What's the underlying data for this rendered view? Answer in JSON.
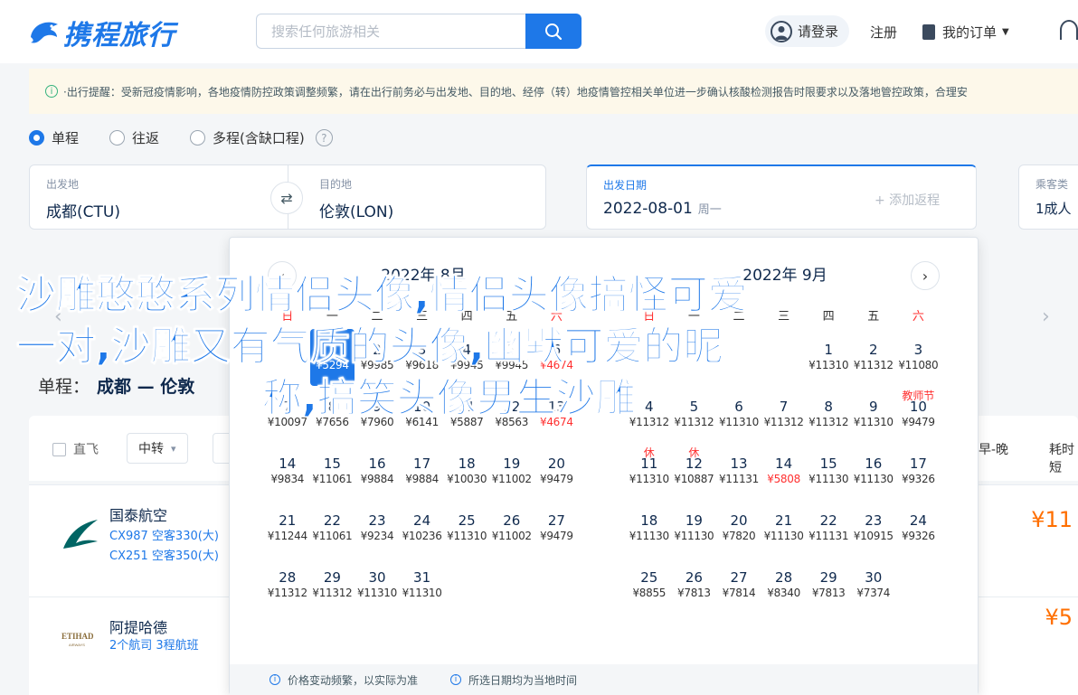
{
  "header": {
    "logo_text": "携程旅行",
    "search_placeholder": "搜索任何旅游相关",
    "login": "请登录",
    "register": "注册",
    "orders": "我的订单"
  },
  "notice": {
    "text": "·出行提醒：受新冠疫情影响，各地疫情防控政策调整频繁，请在出行前务必与出发地、目的地、经停（转）地疫情管控相关单位进一步确认核酸检测报告时限要求以及落地管控政策，合理安"
  },
  "trip_types": {
    "oneway": "单程",
    "roundtrip": "往返",
    "multi": "多程(含缺口程)"
  },
  "form": {
    "from_label": "出发地",
    "from_value": "成都(CTU)",
    "to_label": "目的地",
    "to_value": "伦敦(LON)",
    "date_label": "出发日期",
    "date_value": "2022-08-01",
    "date_weekday": "周一",
    "add_return": "+ 添加返程",
    "pax_label": "乘客类",
    "pax_value": "1成人"
  },
  "results": {
    "route_prefix": "单程：",
    "route_value": "成都 — 伦敦",
    "filter_direct": "直飞",
    "filter_transfer": "中转",
    "sort_early_late": "早-晚",
    "sort_duration": "耗时短",
    "flights": [
      {
        "airline": "国泰航空",
        "line1": "CX987 空客330(大)",
        "line2": "CX251 空客350(大)",
        "price": "¥11"
      },
      {
        "airline": "阿提哈德",
        "line1": "2个航司  3程航班",
        "line2": "",
        "price": "¥5"
      }
    ]
  },
  "calendar": {
    "weekdays": [
      "日",
      "一",
      "二",
      "三",
      "四",
      "五",
      "六"
    ],
    "months": [
      {
        "title": "2022年 8月",
        "offset": 1,
        "days": [
          {
            "d": "1",
            "p": "¥5294",
            "sel": true
          },
          {
            "d": "2",
            "p": "¥9985"
          },
          {
            "d": "3",
            "p": "¥9618"
          },
          {
            "d": "4",
            "p": "¥9945"
          },
          {
            "d": "5",
            "p": "¥9945"
          },
          {
            "d": "6",
            "p": "¥4674",
            "low": true
          },
          {
            "d": "7",
            "p": "¥10097"
          },
          {
            "d": "8",
            "p": "¥7656"
          },
          {
            "d": "9",
            "p": "¥7960"
          },
          {
            "d": "10",
            "p": "¥6141"
          },
          {
            "d": "11",
            "p": "¥5887"
          },
          {
            "d": "12",
            "p": "¥8563"
          },
          {
            "d": "13",
            "p": "¥4674",
            "low": true
          },
          {
            "d": "14",
            "p": "¥9834"
          },
          {
            "d": "15",
            "p": "¥11061"
          },
          {
            "d": "16",
            "p": "¥9884"
          },
          {
            "d": "17",
            "p": "¥9884"
          },
          {
            "d": "18",
            "p": "¥10030"
          },
          {
            "d": "19",
            "p": "¥11002"
          },
          {
            "d": "20",
            "p": "¥9479"
          },
          {
            "d": "21",
            "p": "¥11244"
          },
          {
            "d": "22",
            "p": "¥11061"
          },
          {
            "d": "23",
            "p": "¥9234"
          },
          {
            "d": "24",
            "p": "¥10236"
          },
          {
            "d": "25",
            "p": "¥11310"
          },
          {
            "d": "26",
            "p": "¥11002"
          },
          {
            "d": "27",
            "p": "¥9479"
          },
          {
            "d": "28",
            "p": "¥11312"
          },
          {
            "d": "29",
            "p": "¥11312"
          },
          {
            "d": "30",
            "p": "¥11310"
          },
          {
            "d": "31",
            "p": "¥11310"
          }
        ]
      },
      {
        "title": "2022年 9月",
        "offset": 4,
        "days": [
          {
            "d": "1",
            "p": "¥11310"
          },
          {
            "d": "2",
            "p": "¥11312"
          },
          {
            "d": "3",
            "p": "¥11080"
          },
          {
            "d": "4",
            "p": "¥11312"
          },
          {
            "d": "5",
            "p": "¥11312"
          },
          {
            "d": "6",
            "p": "¥11310"
          },
          {
            "d": "7",
            "p": "¥11312"
          },
          {
            "d": "8",
            "p": "¥11312"
          },
          {
            "d": "9",
            "p": "¥11310"
          },
          {
            "d": "10",
            "p": "¥9479",
            "tag": "教师节"
          },
          {
            "d": "11",
            "p": "¥11310",
            "tag": "休"
          },
          {
            "d": "12",
            "p": "¥10887",
            "tag": "休"
          },
          {
            "d": "13",
            "p": "¥11131"
          },
          {
            "d": "14",
            "p": "¥5808",
            "low": true
          },
          {
            "d": "15",
            "p": "¥11130"
          },
          {
            "d": "16",
            "p": "¥11130"
          },
          {
            "d": "17",
            "p": "¥9326"
          },
          {
            "d": "18",
            "p": "¥11130"
          },
          {
            "d": "19",
            "p": "¥11130"
          },
          {
            "d": "20",
            "p": "¥7820"
          },
          {
            "d": "21",
            "p": "¥11130"
          },
          {
            "d": "22",
            "p": "¥11131"
          },
          {
            "d": "23",
            "p": "¥10915"
          },
          {
            "d": "24",
            "p": "¥9326"
          },
          {
            "d": "25",
            "p": "¥8855"
          },
          {
            "d": "26",
            "p": "¥7813"
          },
          {
            "d": "27",
            "p": "¥7814"
          },
          {
            "d": "28",
            "p": "¥8340"
          },
          {
            "d": "29",
            "p": "¥7813"
          },
          {
            "d": "30",
            "p": "¥7374"
          }
        ]
      }
    ],
    "footer_price_note": "价格变动频繁，以实际为准",
    "footer_time_note": "所选日期均为当地时间"
  },
  "banner": {
    "line1": "沙雕憨憨系列情侣头像,情侣头像搞怪可爱",
    "line2": "一对,沙雕又有气质的头像,幽默可爱的昵",
    "line3": "称,搞笑头像男生沙雕"
  },
  "colors": {
    "brand": "#1e78e8",
    "price": "#ff6f00",
    "holiday": "#ff3030"
  }
}
